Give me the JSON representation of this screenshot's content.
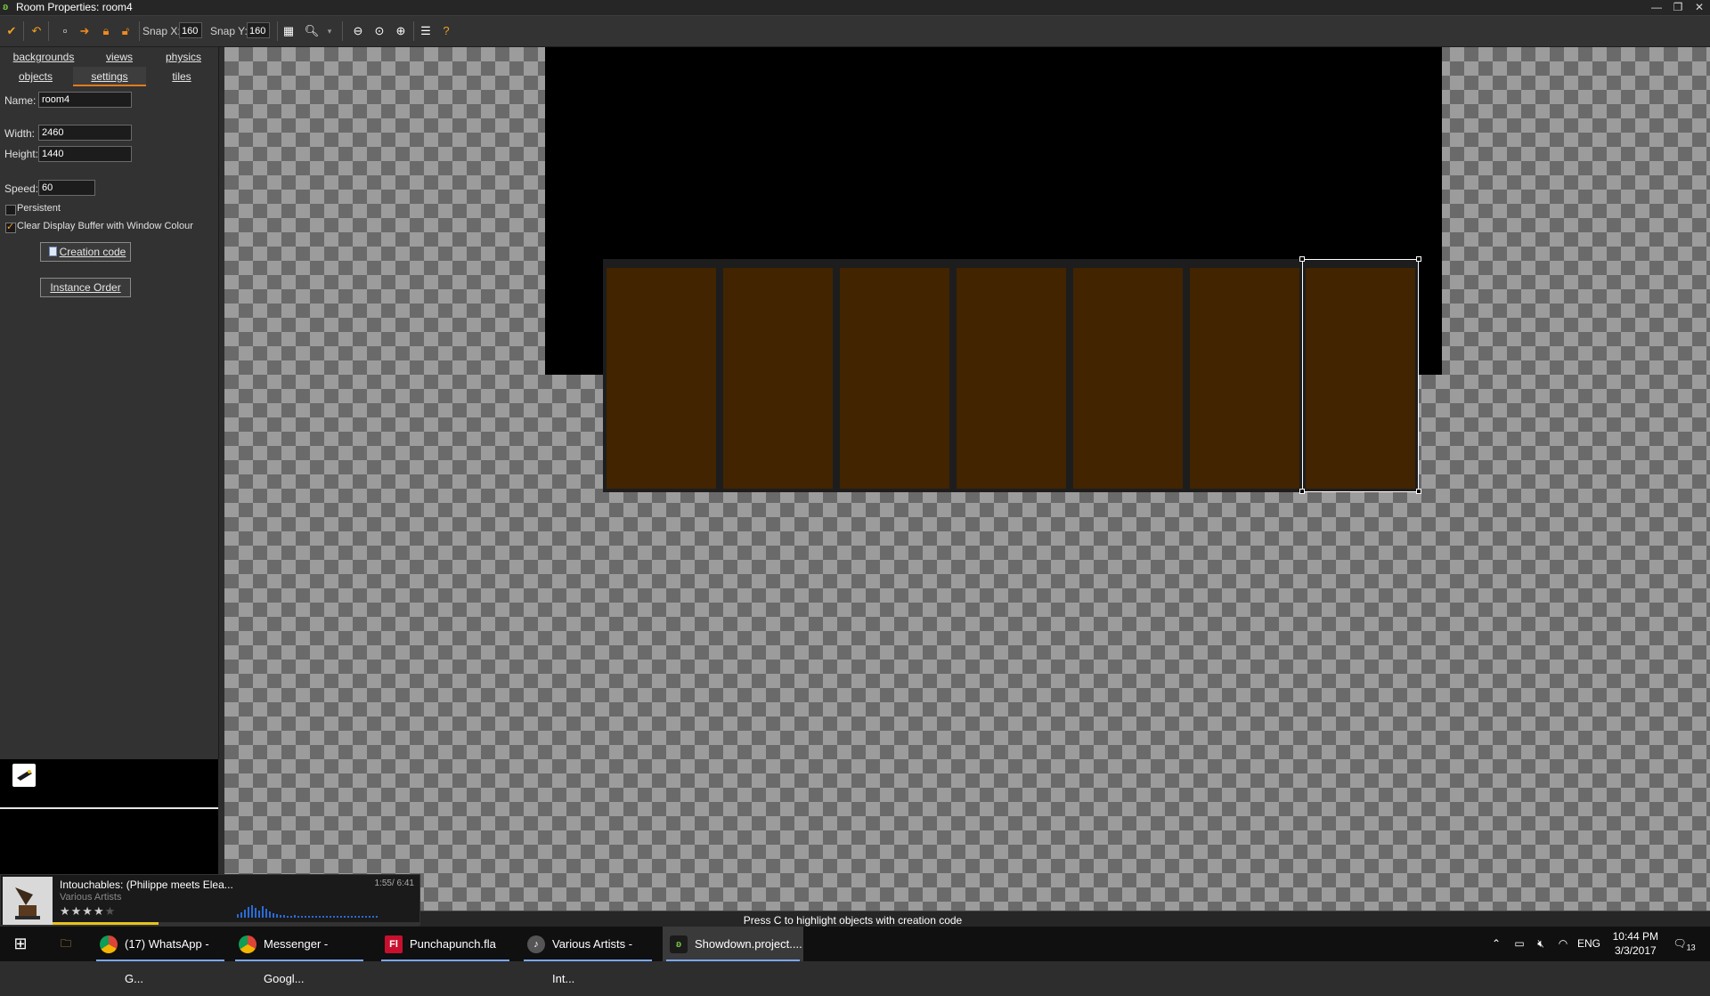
{
  "window": {
    "title": "Room Properties: room4",
    "minimize": "—",
    "restore": "❐",
    "close": "✕"
  },
  "toolbar": {
    "snap_x_label": "Snap X:",
    "snap_x_value": "160",
    "snap_y_label": "Snap Y:",
    "snap_y_value": "160"
  },
  "tabs": {
    "row1": [
      "backgrounds",
      "views",
      "physics"
    ],
    "row2": [
      "objects",
      "settings",
      "tiles"
    ],
    "active": "settings"
  },
  "settings": {
    "name_label": "Name:",
    "name_value": "room4",
    "width_label": "Width:",
    "width_value": "2460",
    "height_label": "Height:",
    "height_value": "1440",
    "speed_label": "Speed:",
    "speed_value": "60",
    "persistent_label": "Persistent",
    "persistent_checked": false,
    "clear_label": "Clear Display Buffer with Window Colour",
    "clear_checked": true,
    "creation_code_button": "Creation code",
    "instance_order_button": "Instance Order"
  },
  "status": {
    "text": "Press C to highlight objects with creation code"
  },
  "player": {
    "track": "Intouchables: (Philippe meets Elea...",
    "artist": "Various Artists",
    "time": "1:55/ 6:41",
    "rating_stars": 4,
    "progress_fraction": 0.29
  },
  "taskbar": {
    "items": [
      {
        "label": "(17) WhatsApp - G...",
        "icon": "chrome-icon"
      },
      {
        "label": "Messenger - Googl...",
        "icon": "chrome-icon"
      },
      {
        "label": "Punchapunch.fla",
        "icon": "flash-icon"
      },
      {
        "label": "Various Artists - Int...",
        "icon": "media-player-icon"
      },
      {
        "label": "Showdown.project....",
        "icon": "gamemaker-icon"
      }
    ],
    "language": "ENG",
    "time": "10:44 PM",
    "date": "3/3/2017",
    "notifications": "13"
  },
  "colors": {
    "accent": "#e07b1c",
    "plank": "#422400",
    "plank_border": "#1d1d1d",
    "room_bg": "#000000"
  }
}
